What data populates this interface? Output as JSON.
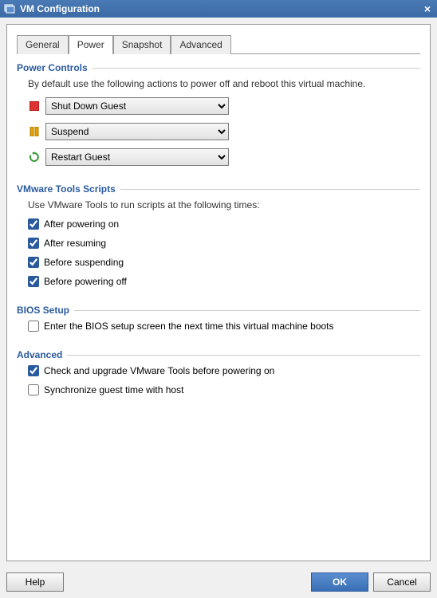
{
  "window": {
    "title": "VM Configuration",
    "close_label": "×"
  },
  "tabs": {
    "general": "General",
    "power": "Power",
    "snapshot": "Snapshot",
    "advanced": "Advanced"
  },
  "sections": {
    "power_controls": {
      "title": "Power Controls",
      "desc": "By default use the following actions to power off and reboot this virtual machine.",
      "shutdown": "Shut Down Guest",
      "suspend": "Suspend",
      "restart": "Restart Guest"
    },
    "tools_scripts": {
      "title": "VMware Tools Scripts",
      "desc": "Use VMware Tools to run scripts at the following times:",
      "after_power_on": "After powering on",
      "after_resuming": "After resuming",
      "before_suspending": "Before suspending",
      "before_powering_off": "Before powering off"
    },
    "bios": {
      "title": "BIOS Setup",
      "enter_bios": "Enter the BIOS setup screen the next time this virtual machine boots"
    },
    "advanced": {
      "title": "Advanced",
      "check_upgrade": "Check and upgrade VMware Tools before powering on",
      "sync_time": "Synchronize guest time with host"
    }
  },
  "buttons": {
    "help": "Help",
    "ok": "OK",
    "cancel": "Cancel"
  }
}
